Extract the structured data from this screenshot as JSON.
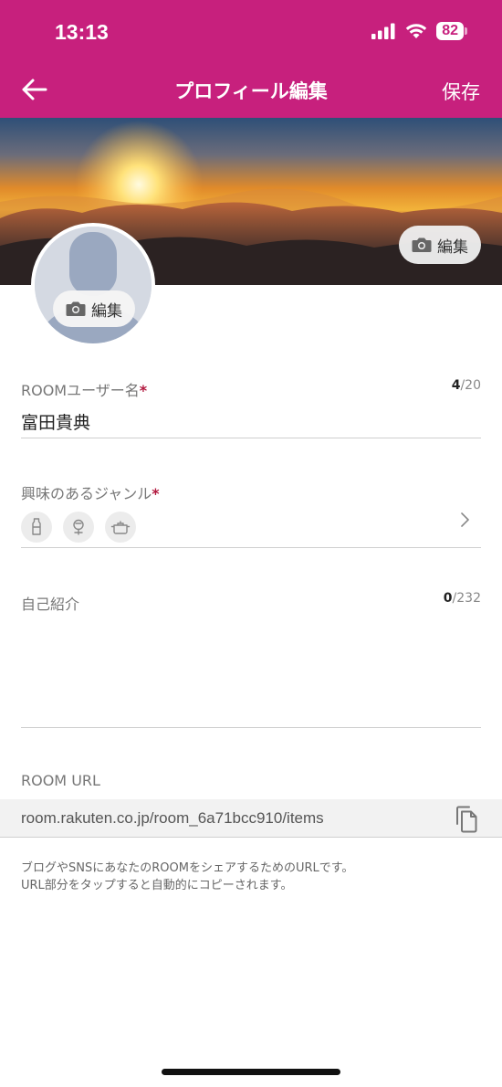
{
  "status_bar": {
    "time": "13:13",
    "battery": "82"
  },
  "nav": {
    "title": "プロフィール編集",
    "save": "保存"
  },
  "cover": {
    "edit_label": "編集"
  },
  "avatar": {
    "edit_label": "編集"
  },
  "username": {
    "label": "ROOMユーザー名",
    "required_mark": "*",
    "value": "富田貴典",
    "count": "4",
    "max": "/20"
  },
  "genre": {
    "label": "興味のあるジャンル",
    "required_mark": "*",
    "icons": [
      "fashion-icon",
      "beauty-icon",
      "cooking-pot-icon"
    ]
  },
  "bio": {
    "label": "自己紹介",
    "count": "0",
    "max": "/232",
    "value": ""
  },
  "room_url": {
    "label": "ROOM URL",
    "value": "room.rakuten.co.jp/room_6a71bcc910/items",
    "help_line1": "ブログやSNSにあなたのROOMをシェアするためのURLです。",
    "help_line2": "URL部分をタップすると自動的にコピーされます。"
  },
  "colors": {
    "brand": "#c7207d",
    "required": "#b1173d"
  }
}
